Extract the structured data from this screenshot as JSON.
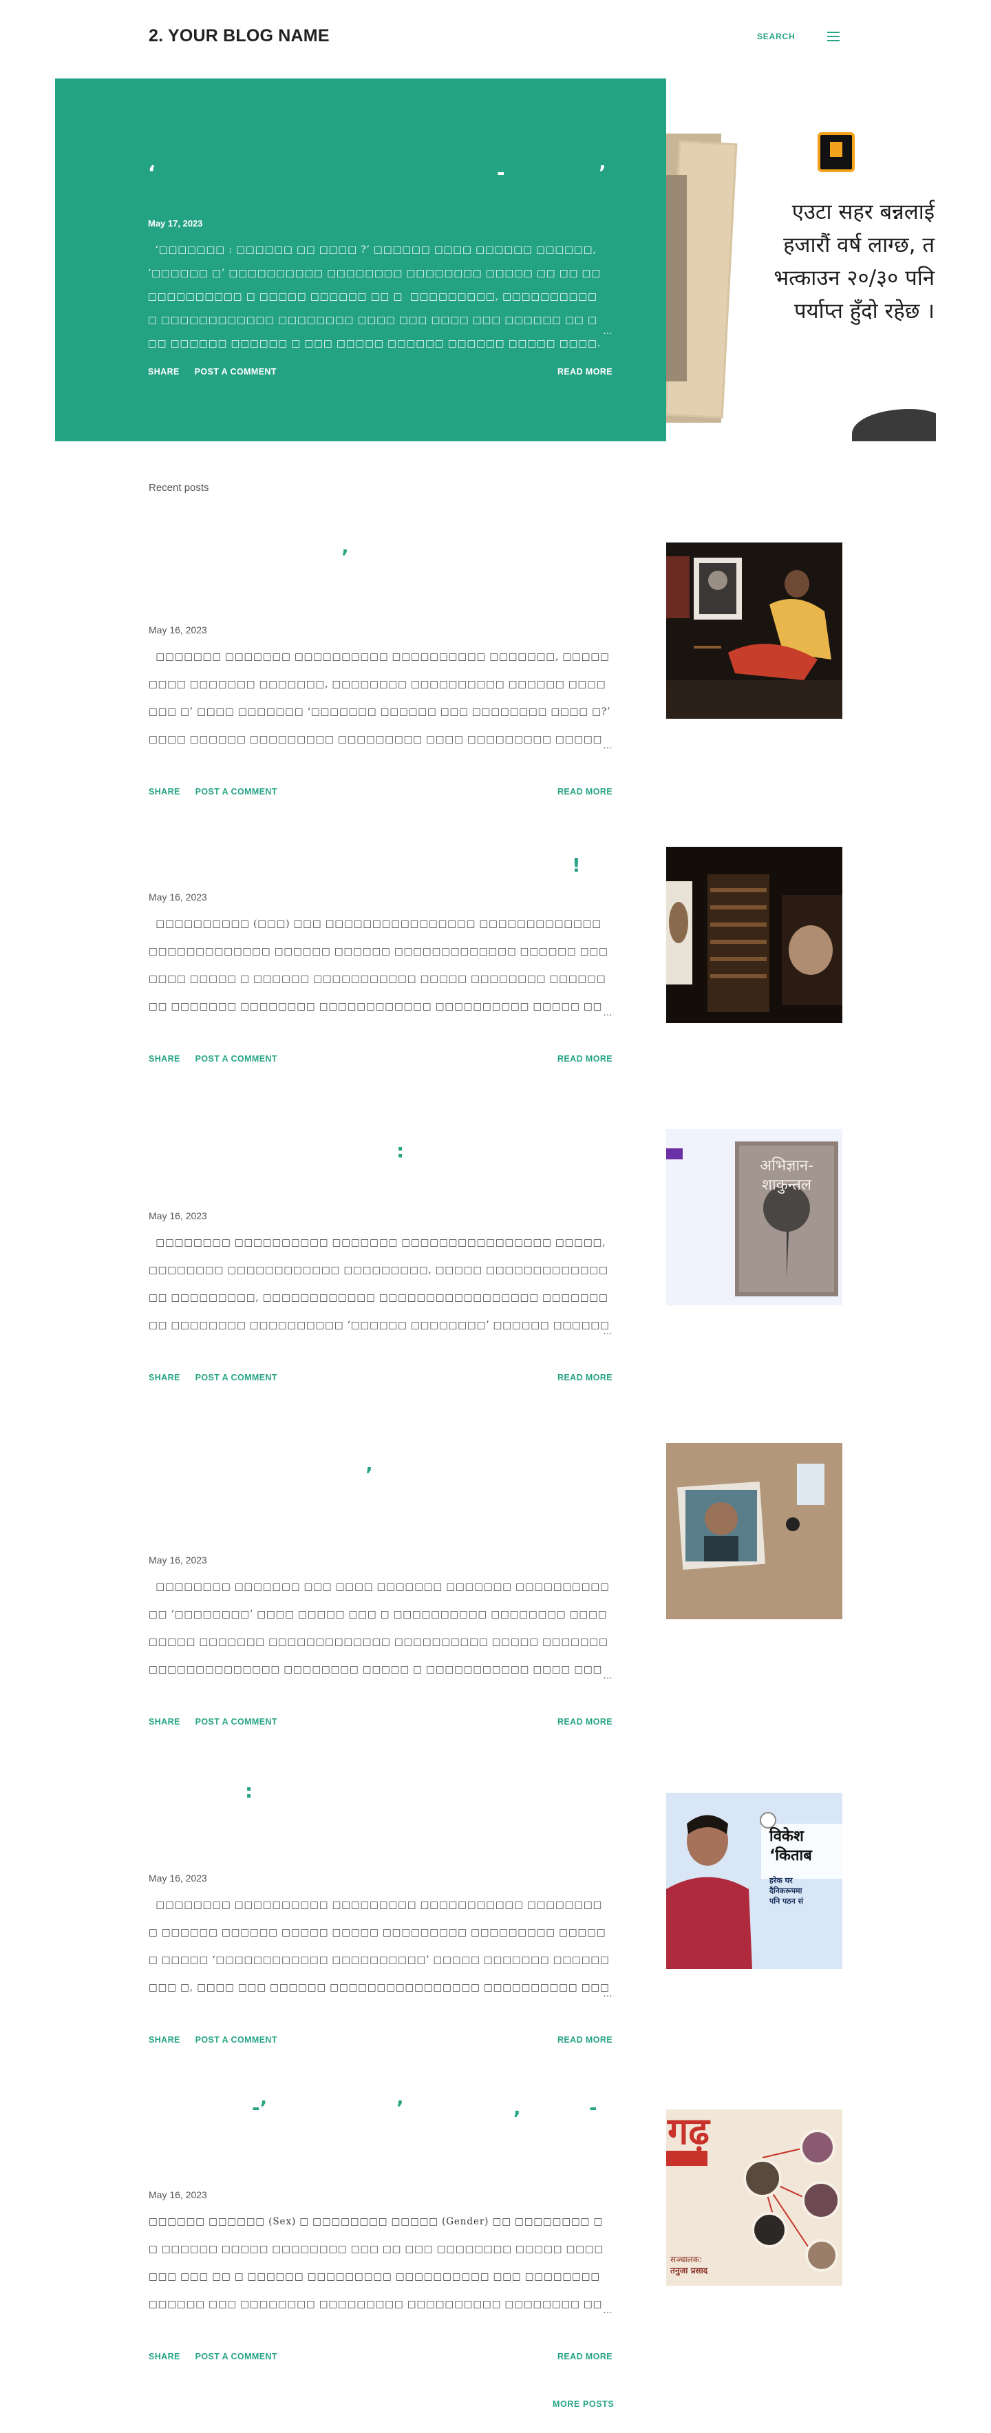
{
  "header": {
    "blog_title": "2. YOUR BLOG NAME",
    "search_label": "SEARCH",
    "menu_icon": "hamburger-menu-icon"
  },
  "featured": {
    "title_marks": [
      "‘",
      "-",
      "’"
    ],
    "date": "May 17, 2023",
    "snippet": "  ‘□□□□□□□ : □□□□□□ □□ □□□□ ?’ □□□□□□ □□□□ □□□□□□ □□□□□□, ‘□□□□□□ □’ □□□□□□□□□□ □□□□□□□□ □□□□□□□□ □□□□□ □□ □□ □□□□□□□□□□□□ □ □□□□□ □□□□□□ □□ □  □□□□□□□□□, □□□□□□□□□□ □ □□□□□□□□□□□□ □□□□□□□□ □□□□ □□□ □□□□ □□□ □□□□□□ □□ □□□ □□□□□□ □□□□□□ □ □□□ □□□□□ □□□□□□ □□□□□□ □□□□□ □□□□.",
    "ellipsis": "…",
    "share_label": "SHARE",
    "comment_label": "POST A COMMENT",
    "read_more_label": "READ MORE",
    "image_text_lines": [
      "एउटा सहर बन्नलाई",
      "हजारौं वर्ष लाग्छ, त",
      "भत्काउन २०/३० पनि",
      "पर्याप्त हुँदो रहेछ ।"
    ]
  },
  "recent_label": "Recent posts",
  "posts": [
    {
      "title_marks": [
        "’"
      ],
      "date": "May 16, 2023",
      "snippet": "  □□□□□□□ □□□□□□□ □□□□□□□□□□ □□□□□□□□□□ □□□□□□□, □□□□□□□□□ □□□□□□□ □□□□□□□, □□□□□□□□ □□□□□□□□□□ □□□□□□ □□□□□□□ □’ □□□□ □□□□□□□ ‘□□□□□□□ □□□□□□ □□□ □□□□□□□□ □□□□ □?’ □□□□ □□□□□□ □□□□□□□□□ □□□□□□□□□ □□□□ □□□□□□□□□ □□□□□□□□□□ □□ □□□□□□□□ □□□□□□ □□□□ □, □□□□ □, □□□□□□□□□□ □□ □□ □□□□□□□ □ □",
      "ellipsis": "…",
      "share_label": "SHARE",
      "comment_label": "POST A COMMENT",
      "read_more_label": "READ MORE"
    },
    {
      "title_marks": [
        "!"
      ],
      "date": "May 16, 2023",
      "snippet": "  □□□□□□□□□□ (□□□) □□□ □□□□□□□□□□□□□□□□ □□□□□□□□□□□□□ □□□□□□□□□□□□□ □□□□□□ □□□□□□ □□□□□□□□□□□□□ □□□□□□ □□□□□□□ □□□□□ □ □□□□□□ □□□□□□□□□□□ □□□□□ □□□□□□□□ □□□□□□□□ □□□□□□□ □□□□□□□□ □□□□□□□□□□□□ □□□□□□□□□□ □□□□□ □□□□□□□ □□□□□□□□ □□□□□□□□ □□□□□□ □□□□ □□- ‘□□□□’ □ ‘□□□□’ □□□□□□□□",
      "ellipsis": "…",
      "share_label": "SHARE",
      "comment_label": "POST A COMMENT",
      "read_more_label": "READ MORE"
    },
    {
      "title_marks": [
        ":"
      ],
      "date": "May 16, 2023",
      "snippet": "  □□□□□□□□ □□□□□□□□□□ □□□□□□□ □□□□□□□□□□□□□□□□ □□□□□, □□□□□□□□ □□□□□□□□□□□□ □□□□□□□□□, □□□□□ □□□□□□□□□□□□□□□ □□□□□□□□□, □□□□□□□□□□□□ □□□□□□□□□□□□□□□□□ □□□□□□□□□ □□□□□□□□ □□□□□□□□□□ ‘□□□□□□ □□□□□□□□’ □□□□□□ □□□□□□□□□□ □□□□□□□□□□ □□□□ □□□□□□□□ □□ □□□□ □□□ □ □ □□□□□□□□□□",
      "ellipsis": "…",
      "share_label": "SHARE",
      "comment_label": "POST A COMMENT",
      "read_more_label": "READ MORE"
    },
    {
      "title_marks": [
        "’"
      ],
      "date": "May 16, 2023",
      "snippet": "  □□□□□□□□ □□□□□□□ □□□ □□□□ □□□□□□□ □□□□□□□ □□□□□□□□□□□□ ‘□□□□□□□□’ □□□□ □□□□□ □□□ □ □□□□□□□□□□ □□□□□□□□ □□□□□□□□□ □□□□□□□ □□□□□□□□□□□□□ □□□□□□□□□□ □□□□□ □□□□□□□ □□□□□□□□□□□□□□ □□□□□□□□ □□□□□ □ □□□□□□□□□□□ □□□□ □□□□□□ ‘□□□□□□□□ □□□□□□’ □□□□□□□□ □□□□□□ □□□ □ □□□□ ‘□□□□□□ □□□□□’ □□□□ □",
      "ellipsis": "…",
      "share_label": "SHARE",
      "comment_label": "POST A COMMENT",
      "read_more_label": "READ MORE"
    },
    {
      "title_marks": [
        ":"
      ],
      "date": "May 16, 2023",
      "snippet": "  □□□□□□□□ □□□□□□□□□□ □□□□□□□□□ □□□□□□□□□□□ □□□□□□□□□ □□□□□□ □□□□□□ □□□□□ □□□□□ □□□□□□□□□ □□□□□□□□□ □□□□□□ □□□□□ ‘□□□□□□□□□□□□ □□□□□□□□□□’ □□□□□ □□□□□□□ □□□□□□ □□□ □, □□□□ □□□ □□□□□□ □□□□□□□□□□□□□□□□ □□□□□□□□□□ □□□□□□□□ □ □□□□□□□□□□ □, □□□□ □□□□□□ □□□□□□ □□□□ □□□□□□ □□□□□□□□□ □□□□ □□□□□□□ □ □□□",
      "ellipsis": "…",
      "share_label": "SHARE",
      "comment_label": "POST A COMMENT",
      "read_more_label": "READ MORE"
    },
    {
      "title_marks": [
        "-’",
        "’",
        ",",
        "-"
      ],
      "date": "May 16, 2023",
      "snippet": "□□□□□□ □□□□□□ (Sex) □ □□□□□□□□ □□□□□ (Gender) □□ □□□□□□□□ □ □ □□□□□□ □□□□□ □□□□□□□□ □□□ □□ □□□ □□□□□□□□ □□□□□ □□□□□□□ □□□ □□ □ □□□□□□ □□□□□□□□□ □□□□□□□□□□ □□□ □□□□□□□□ □□□□□□ □□□ □□□□□□□□ □□□□□□□□□ □□□□□□□□□□ □□□□□□□□ □□□□□□, □□□□□□□□, □□□□□□, □□□□□□□□ □□□□□ □ □□□□□□□□□□□□□□□ □□□□ □□□□□□□ □□□□",
      "ellipsis": "…",
      "share_label": "SHARE",
      "comment_label": "POST A COMMENT",
      "read_more_label": "READ MORE"
    }
  ],
  "thumb_texts": {
    "post3": [
      "अभिज्ञान-",
      "शाकुन्तल"
    ],
    "post5": [
      "विकेश",
      "‘किताब",
      "हरेक घर",
      "दैनिकरूपमा",
      "पनि पठन सं"
    ],
    "post6": [
      "गढ़",
      "सञ्चालक:",
      "तनुजा प्रसाद"
    ]
  },
  "more_posts_label": "MORE POSTS",
  "colors": {
    "accent": "#26a485",
    "featured_bg": "#24a284",
    "text": "#444444"
  }
}
